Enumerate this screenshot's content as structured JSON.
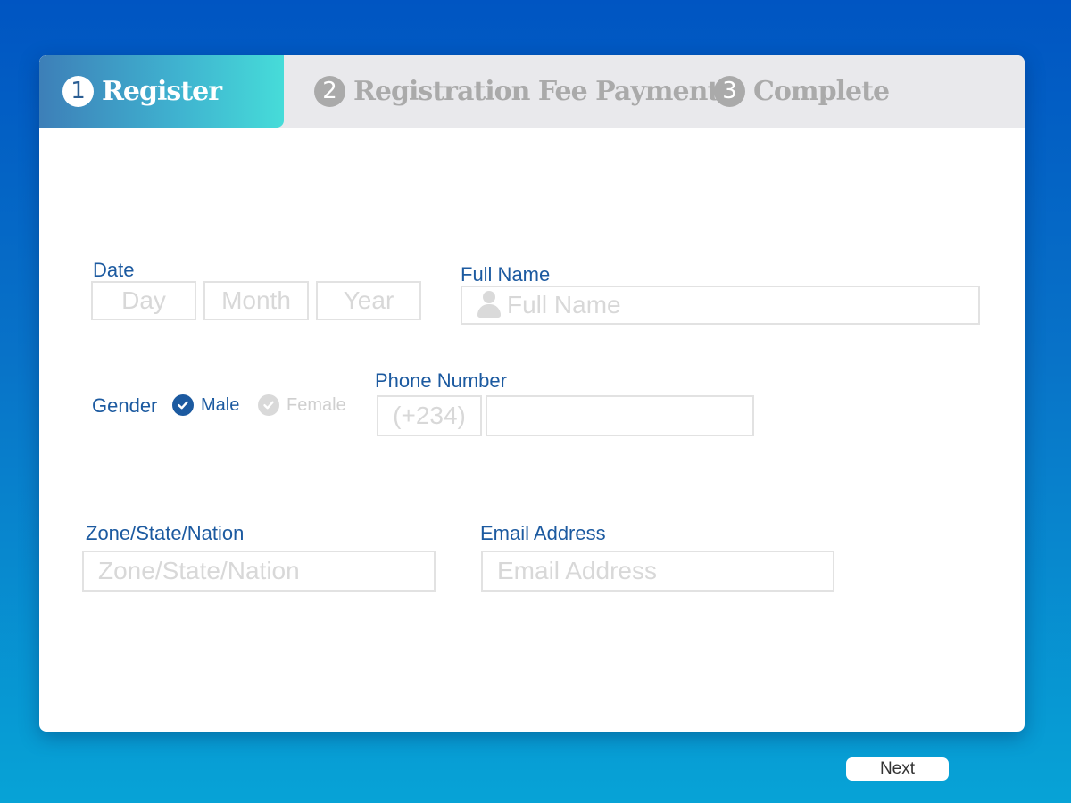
{
  "steps": [
    {
      "number": "1",
      "label": "Register"
    },
    {
      "number": "2",
      "label": "Registration Fee Payment"
    },
    {
      "number": "3",
      "label": "Complete"
    }
  ],
  "form": {
    "date": {
      "label": "Date",
      "day_placeholder": "Day",
      "month_placeholder": "Month",
      "year_placeholder": "Year"
    },
    "full_name": {
      "label": "Full Name",
      "placeholder": "Full Name"
    },
    "gender": {
      "label": "Gender",
      "options": [
        {
          "label": "Male",
          "selected": true
        },
        {
          "label": "Female",
          "selected": false
        }
      ]
    },
    "phone": {
      "label": "Phone Number",
      "prefix": "(+234)",
      "value": ""
    },
    "zone": {
      "label": "Zone/State/Nation",
      "placeholder": "Zone/State/Nation"
    },
    "email": {
      "label": "Email Address",
      "placeholder": "Email Address"
    }
  },
  "next_button": {
    "label": "Next"
  },
  "colors": {
    "accent": "#1c5aa0",
    "active_step_start": "#3d7fb8",
    "active_step_end": "#46dcd9",
    "inactive_step": "#aaaaaa"
  },
  "icons": {
    "full_name": "person-icon",
    "gender_selected": "check-circle-icon",
    "gender_unselected": "check-circle-icon"
  }
}
